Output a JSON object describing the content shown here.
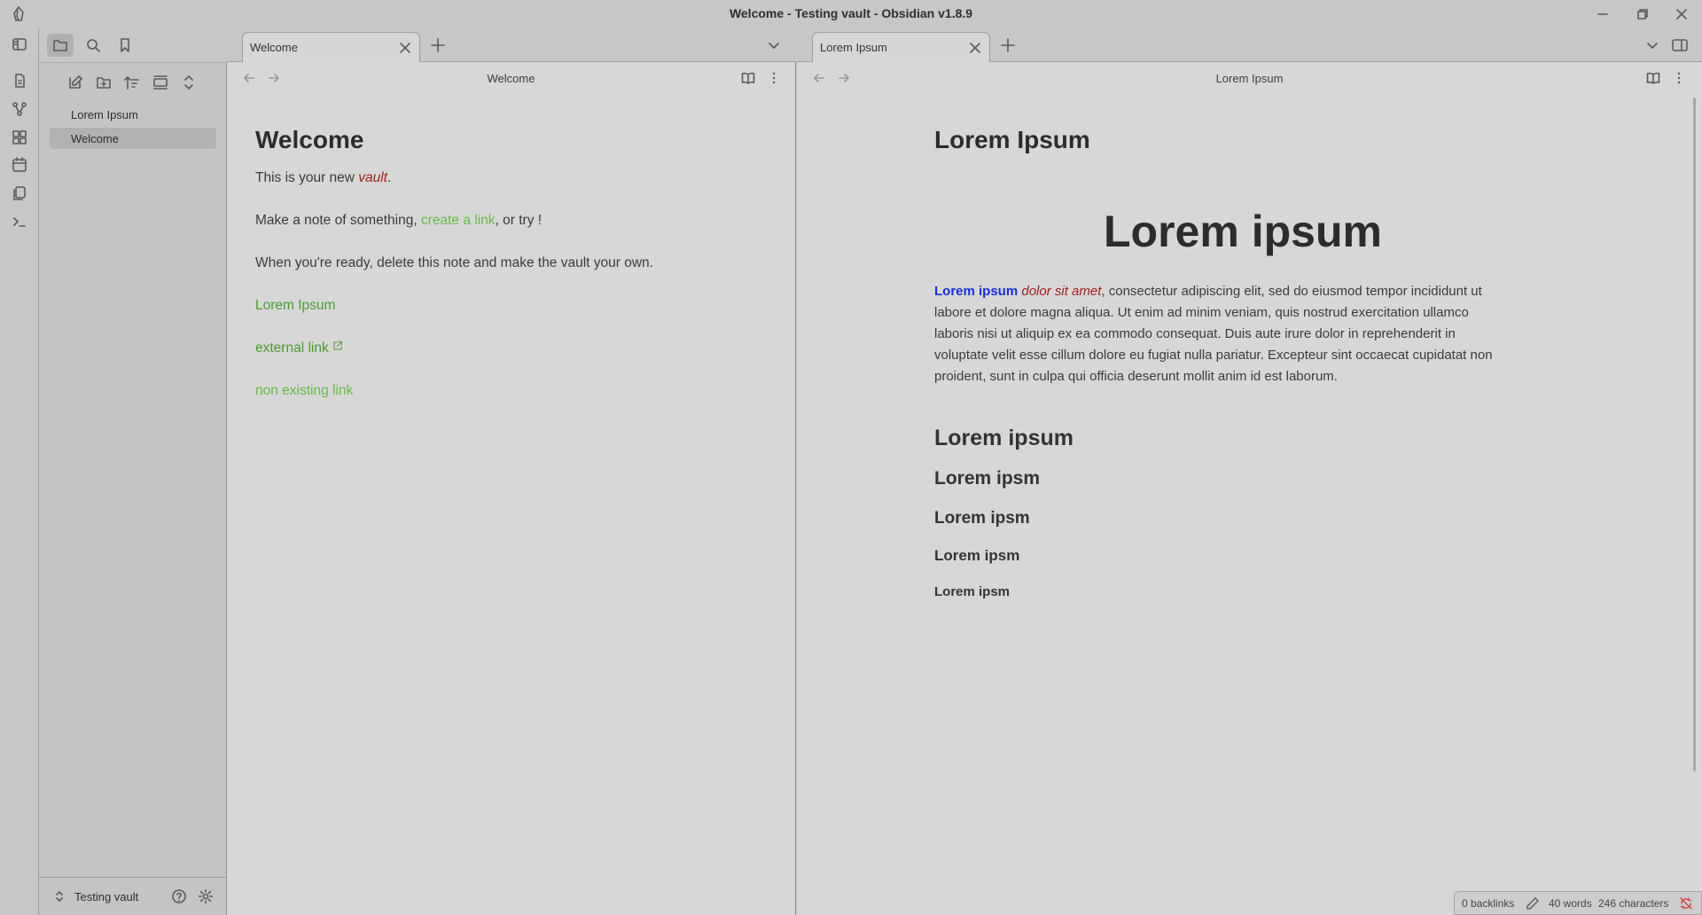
{
  "window": {
    "title": "Welcome - Testing vault - Obsidian v1.8.9"
  },
  "sidebar": {
    "files": [
      {
        "label": "Lorem Ipsum"
      },
      {
        "label": "Welcome"
      }
    ],
    "vault_name": "Testing vault"
  },
  "left_pane": {
    "tab_label": "Welcome",
    "view_title": "Welcome",
    "note": {
      "heading": "Welcome",
      "p1_prefix": "This is your new ",
      "p1_link": "vault",
      "p1_suffix": ".",
      "p2_prefix": "Make a note of something, ",
      "p2_link": "create a link",
      "p2_suffix": ", or try !",
      "p3": "When you're ready, delete this note and make the vault your own.",
      "link_lorem": "Lorem Ipsum",
      "link_external": "external link",
      "link_nonexisting": "non existing link"
    }
  },
  "right_pane": {
    "tab_label": "Lorem Ipsum",
    "view_title": "Lorem Ipsum",
    "note": {
      "title": "Lorem Ipsum",
      "h1": "Lorem ipsum",
      "para_bold_blue": "Lorem ipsum",
      "para_italic_red": "dolor sit amet",
      "para_line1": ", consectetur adipiscing elit, sed do eiusmod tempor incididunt ut",
      "para_line2": "labore et dolore magna aliqua. Ut enim ad minim veniam, quis nostrud exercitation ullamco",
      "para_line3": "laboris nisi ut aliquip ex ea commodo consequat. Duis aute irure dolor in reprehenderit in",
      "para_line4": "voluptate velit esse cillum dolore eu fugiat nulla pariatur. Excepteur sint occaecat cupidatat non",
      "para_line5": "proident, sunt in culpa qui officia deserunt mollit anim id est laborum.",
      "h2": "Lorem ipsum",
      "h3": "Lorem ipsm",
      "h4": "Lorem ipsm",
      "h5": "Lorem ipsm",
      "h6": "Lorem ipsm"
    }
  },
  "statusbar": {
    "backlinks": "0 backlinks",
    "words": "40 words",
    "characters": "246 characters"
  },
  "colors": {
    "background": "#c7c7c7",
    "pane": "#d7d7d7",
    "link": "#4c9a2f",
    "italic_accent": "#9d1c1c",
    "bold_accent": "#1a2fd8"
  }
}
